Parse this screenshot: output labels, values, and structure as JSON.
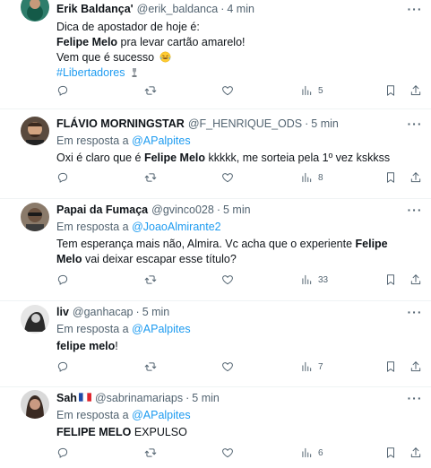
{
  "tweets": [
    {
      "name": "Erik Baldança'",
      "handle": "@erik_baldanca",
      "sep": "·",
      "time": "4 min",
      "lines": [
        {
          "plain": "Dica de apostador de hoje é:"
        },
        {
          "bold": "Felipe Melo",
          "after": " pra levar cartão amarelo!"
        },
        {
          "plain": "Vem que é sucesso",
          "emoji": "rofl-emoji"
        },
        {
          "hashtag": "#Libertadores",
          "icon": "trophy-icon"
        }
      ],
      "views": "5"
    },
    {
      "name": "FLÁVIO MORNINGSTAR",
      "handle": "@F_HENRIQUE_ODS",
      "sep": "·",
      "time": "5 min",
      "reply_prefix": "Em resposta a",
      "reply_handle": "@APalpites",
      "line_before": "Oxi é claro que é ",
      "line_bold": "Felipe Melo",
      "line_after": " kkkkk, me sorteia pela 1º vez kskkss",
      "views": "8"
    },
    {
      "name": "Papai da Fumaça",
      "handle": "@gvinco028",
      "sep": "·",
      "time": "5 min",
      "reply_prefix": "Em resposta a",
      "reply_handle": "@JoaoAlmirante2",
      "line_before": "Tem esperança mais não, Almira. Vc acha que o experiente ",
      "line_bold": "Felipe Melo",
      "line_after": " vai deixar escapar esse título?",
      "views": "33"
    },
    {
      "name": "liv",
      "handle": "@ganhacap",
      "sep": "·",
      "time": "5 min",
      "reply_prefix": "Em resposta a",
      "reply_handle": "@APalpites",
      "line_bold": "felipe melo",
      "line_after": "!",
      "views": "7"
    },
    {
      "name": "Sah",
      "flag": "france-flag-icon",
      "handle": "@sabrinamariaps",
      "sep": "·",
      "time": "5 min",
      "reply_prefix": "Em resposta a",
      "reply_handle": "@APalpites",
      "line_bold": "FELIPE MELO",
      "line_after": " EXPULSO",
      "views": "6"
    }
  ],
  "icons": {
    "more": "more-icon",
    "reply": "reply-icon",
    "retweet": "retweet-icon",
    "like": "like-icon",
    "views": "views-icon",
    "bookmark": "bookmark-icon",
    "share": "share-icon"
  },
  "colors": {
    "link": "#1d9bf0",
    "secondary_text": "#536471",
    "primary_text": "#0f1419",
    "divider": "#eff3f4"
  }
}
